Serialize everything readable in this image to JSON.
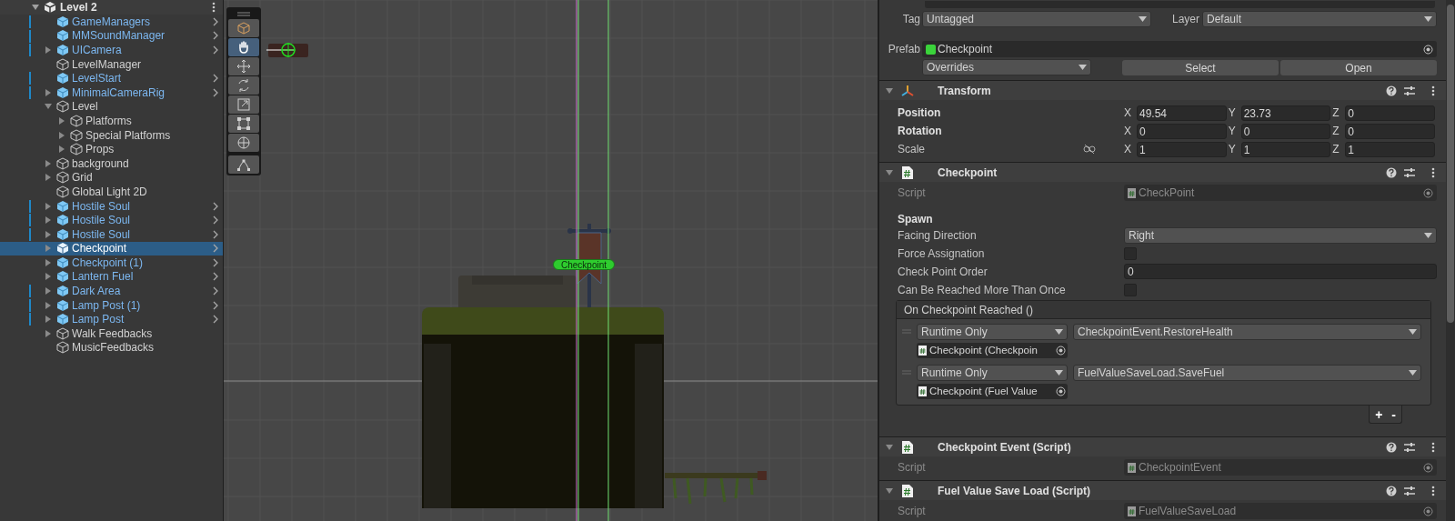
{
  "hierarchy": {
    "root": {
      "label": "Level 2",
      "expanded": true,
      "children": [
        {
          "label": "GameManagers",
          "kind": "prefab",
          "expandable": false,
          "selected": false,
          "modified": true
        },
        {
          "label": "MMSoundManager",
          "kind": "prefab",
          "expandable": false,
          "selected": false,
          "modified": true
        },
        {
          "label": "UICamera",
          "kind": "prefab",
          "expandable": true,
          "expanded": false,
          "selected": false,
          "modified": true
        },
        {
          "label": "LevelManager",
          "kind": "object",
          "expandable": false,
          "selected": false,
          "modified": false
        },
        {
          "label": "LevelStart",
          "kind": "prefab",
          "expandable": false,
          "selected": false,
          "modified": true
        },
        {
          "label": "MinimalCameraRig",
          "kind": "prefab",
          "expandable": true,
          "expanded": false,
          "selected": false,
          "modified": true
        },
        {
          "label": "Level",
          "kind": "object",
          "expandable": true,
          "expanded": true,
          "selected": false,
          "modified": false,
          "children": [
            {
              "label": "Platforms",
              "kind": "object",
              "expandable": true,
              "expanded": false,
              "selected": false,
              "modified": false
            },
            {
              "label": "Special Platforms",
              "kind": "object",
              "expandable": true,
              "expanded": false,
              "selected": false,
              "modified": false
            },
            {
              "label": "Props",
              "kind": "object",
              "expandable": true,
              "expanded": false,
              "selected": false,
              "modified": false
            }
          ]
        },
        {
          "label": "background",
          "kind": "object",
          "expandable": true,
          "expanded": false,
          "selected": false,
          "modified": false
        },
        {
          "label": "Grid",
          "kind": "object",
          "expandable": true,
          "expanded": false,
          "selected": false,
          "modified": false
        },
        {
          "label": "Global Light 2D",
          "kind": "object",
          "expandable": false,
          "selected": false,
          "modified": false
        },
        {
          "label": "Hostile Soul",
          "kind": "prefab",
          "expandable": true,
          "expanded": false,
          "selected": false,
          "modified": true
        },
        {
          "label": "Hostile Soul",
          "kind": "prefab",
          "expandable": true,
          "expanded": false,
          "selected": false,
          "modified": true
        },
        {
          "label": "Hostile Soul",
          "kind": "prefab",
          "expandable": true,
          "expanded": false,
          "selected": false,
          "modified": true
        },
        {
          "label": "Checkpoint",
          "kind": "prefab",
          "expandable": true,
          "expanded": false,
          "selected": true,
          "modified": false
        },
        {
          "label": "Checkpoint (1)",
          "kind": "prefab",
          "expandable": true,
          "expanded": false,
          "selected": false,
          "modified": false
        },
        {
          "label": "Lantern Fuel",
          "kind": "prefab",
          "expandable": true,
          "expanded": false,
          "selected": false,
          "modified": false
        },
        {
          "label": "Dark Area",
          "kind": "prefab",
          "expandable": true,
          "expanded": false,
          "selected": false,
          "modified": true
        },
        {
          "label": "Lamp Post (1)",
          "kind": "prefab",
          "expandable": true,
          "expanded": false,
          "selected": false,
          "modified": true
        },
        {
          "label": "Lamp Post",
          "kind": "prefab",
          "expandable": true,
          "expanded": false,
          "selected": false,
          "modified": true
        },
        {
          "label": "Walk Feedbacks",
          "kind": "object",
          "expandable": true,
          "expanded": false,
          "selected": false,
          "modified": false
        },
        {
          "label": "MusicFeedbacks",
          "kind": "object",
          "expandable": false,
          "selected": false,
          "modified": false
        }
      ]
    }
  },
  "scene": {
    "tools": [
      {
        "kind": "view",
        "selected": false
      },
      {
        "kind": "hand",
        "selected": true
      },
      {
        "kind": "move",
        "selected": false
      },
      {
        "kind": "rotate",
        "selected": false
      },
      {
        "kind": "scale",
        "selected": false
      },
      {
        "kind": "rect",
        "selected": false
      },
      {
        "kind": "transform",
        "selected": false
      },
      {
        "kind": "custom",
        "selected": false
      }
    ],
    "object_label": "Checkpoint"
  },
  "inspector": {
    "tag_label": "Tag",
    "tag": "Untagged",
    "layer_label": "Layer",
    "layer": "Default",
    "prefab_label": "Prefab",
    "prefab": "Checkpoint",
    "overrides": "Overrides",
    "buttons": [
      "Select",
      "Open"
    ],
    "components": [
      {
        "kind": "transform",
        "title": "Transform",
        "expanded": true,
        "rows": [
          {
            "label": "Position",
            "bold": true,
            "linked_icon": false,
            "axes": [
              {
                "axis": "X",
                "value": "49.54"
              },
              {
                "axis": "Y",
                "value": "23.73"
              },
              {
                "axis": "Z",
                "value": "0"
              }
            ]
          },
          {
            "label": "Rotation",
            "bold": true,
            "linked_icon": false,
            "axes": [
              {
                "axis": "X",
                "value": "0"
              },
              {
                "axis": "Y",
                "value": "0"
              },
              {
                "axis": "Z",
                "value": "0"
              }
            ]
          },
          {
            "label": "Scale",
            "bold": false,
            "linked_icon": true,
            "axes": [
              {
                "axis": "X",
                "value": "1"
              },
              {
                "axis": "Y",
                "value": "1"
              },
              {
                "axis": "Z",
                "value": "1"
              }
            ]
          }
        ]
      },
      {
        "kind": "checkpoint",
        "title": "Checkpoint",
        "expanded": true,
        "script_label": "Script",
        "script": "CheckPoint",
        "section": "Spawn",
        "fields": [
          {
            "kind": "dropdown",
            "label": "Facing Direction",
            "value": "Right"
          },
          {
            "kind": "checkbox",
            "label": "Force Assignation",
            "checked": false
          },
          {
            "kind": "number",
            "label": "Check Point Order",
            "value": "0"
          },
          {
            "kind": "checkbox",
            "label": "Can Be Reached More Than Once",
            "checked": false
          }
        ],
        "event": {
          "title": "On Checkpoint Reached ()",
          "entries": [
            {
              "mode": "Runtime Only",
              "function": "CheckpointEvent.RestoreHealth",
              "target": "Checkpoint (Checkpoin"
            },
            {
              "mode": "Runtime Only",
              "function": "FuelValueSaveLoad.SaveFuel",
              "target": "Checkpoint (Fuel Value"
            }
          ],
          "add": "+",
          "remove": "-"
        }
      },
      {
        "kind": "script",
        "title": "Checkpoint Event (Script)",
        "expanded": true,
        "script_label": "Script",
        "script": "CheckpointEvent"
      },
      {
        "kind": "script",
        "title": "Fuel Value Save Load (Script)",
        "expanded": true,
        "script_label": "Script",
        "script": "FuelValueSaveLoad"
      }
    ]
  }
}
